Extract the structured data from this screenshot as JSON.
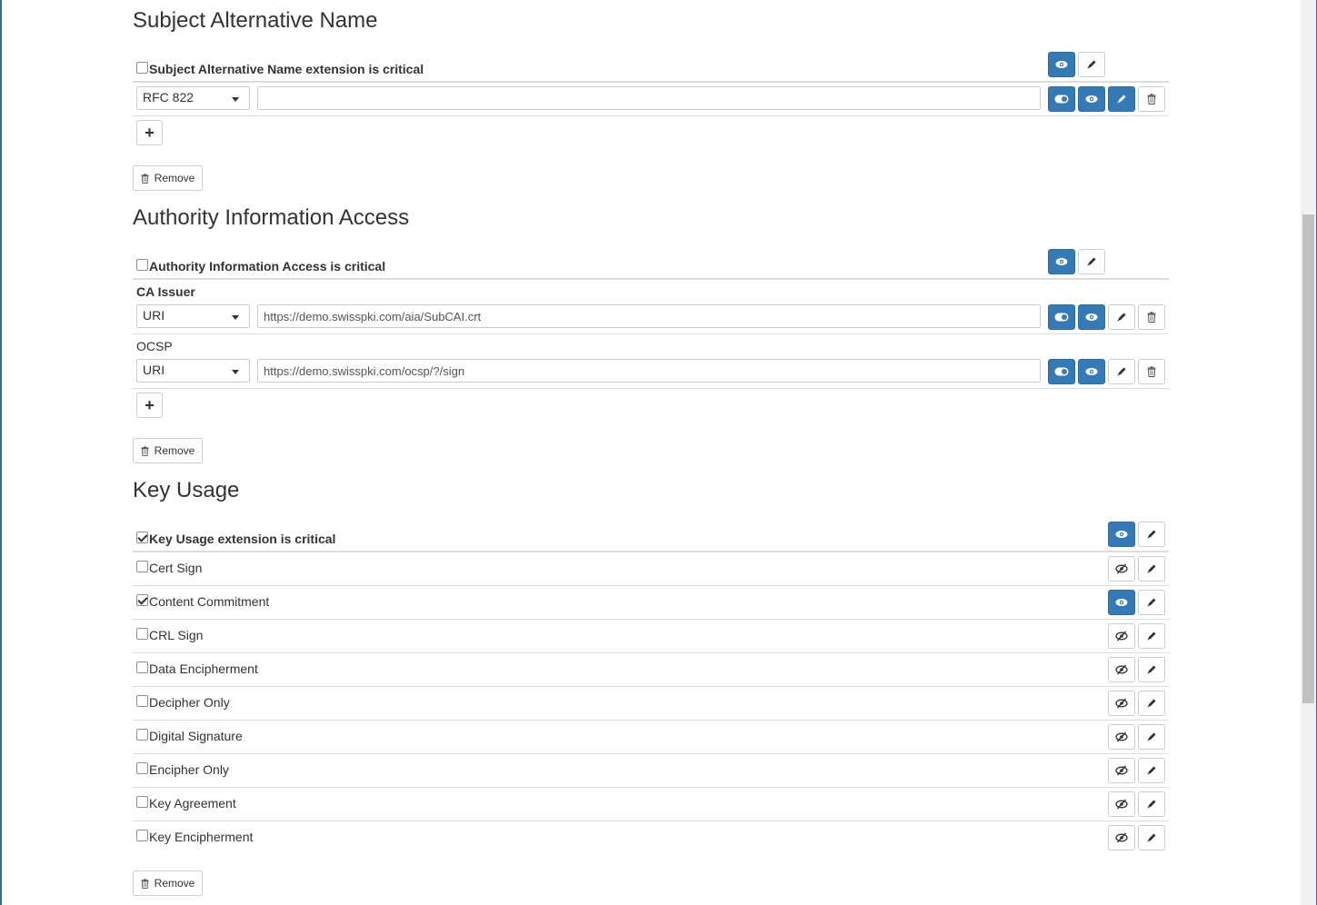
{
  "san": {
    "title": "Subject Alternative Name",
    "critical_label": "Subject Alternative Name extension is critical",
    "critical_checked": false,
    "entry": {
      "type": "RFC 822",
      "value": ""
    },
    "add_label": "+",
    "remove_label": "Remove"
  },
  "aia": {
    "title": "Authority Information Access",
    "critical_label": "Authority Information Access is critical",
    "critical_checked": false,
    "ca_issuer_label": "CA Issuer",
    "ca_issuer": {
      "type": "URI",
      "value": "https://demo.swisspki.com/aia/SubCAI.crt"
    },
    "ocsp_label": "OCSP",
    "ocsp": {
      "type": "URI",
      "value": "https://demo.swisspki.com/ocsp/?/sign"
    },
    "add_label": "+",
    "remove_label": "Remove"
  },
  "key_usage": {
    "title": "Key Usage",
    "critical_label": "Key Usage extension is critical",
    "critical_checked": true,
    "items": [
      {
        "label": "Cert Sign",
        "checked": false,
        "visible": false
      },
      {
        "label": "Content Commitment",
        "checked": true,
        "visible": true
      },
      {
        "label": "CRL Sign",
        "checked": false,
        "visible": false
      },
      {
        "label": "Data Encipherment",
        "checked": false,
        "visible": false
      },
      {
        "label": "Decipher Only",
        "checked": false,
        "visible": false
      },
      {
        "label": "Digital Signature",
        "checked": false,
        "visible": false
      },
      {
        "label": "Encipher Only",
        "checked": false,
        "visible": false
      },
      {
        "label": "Key Agreement",
        "checked": false,
        "visible": false
      },
      {
        "label": "Key Encipherment",
        "checked": false,
        "visible": false
      }
    ],
    "remove_label": "Remove"
  },
  "icons": {
    "eye": "eye-icon",
    "eye_slash": "eye-slash-icon",
    "pencil": "pencil-icon",
    "toggle": "toggle-on-icon",
    "trash": "trash-icon"
  },
  "colors": {
    "primary": "#337ab7",
    "border": "#cccccc",
    "divider": "#dddddd",
    "text": "#333333"
  }
}
